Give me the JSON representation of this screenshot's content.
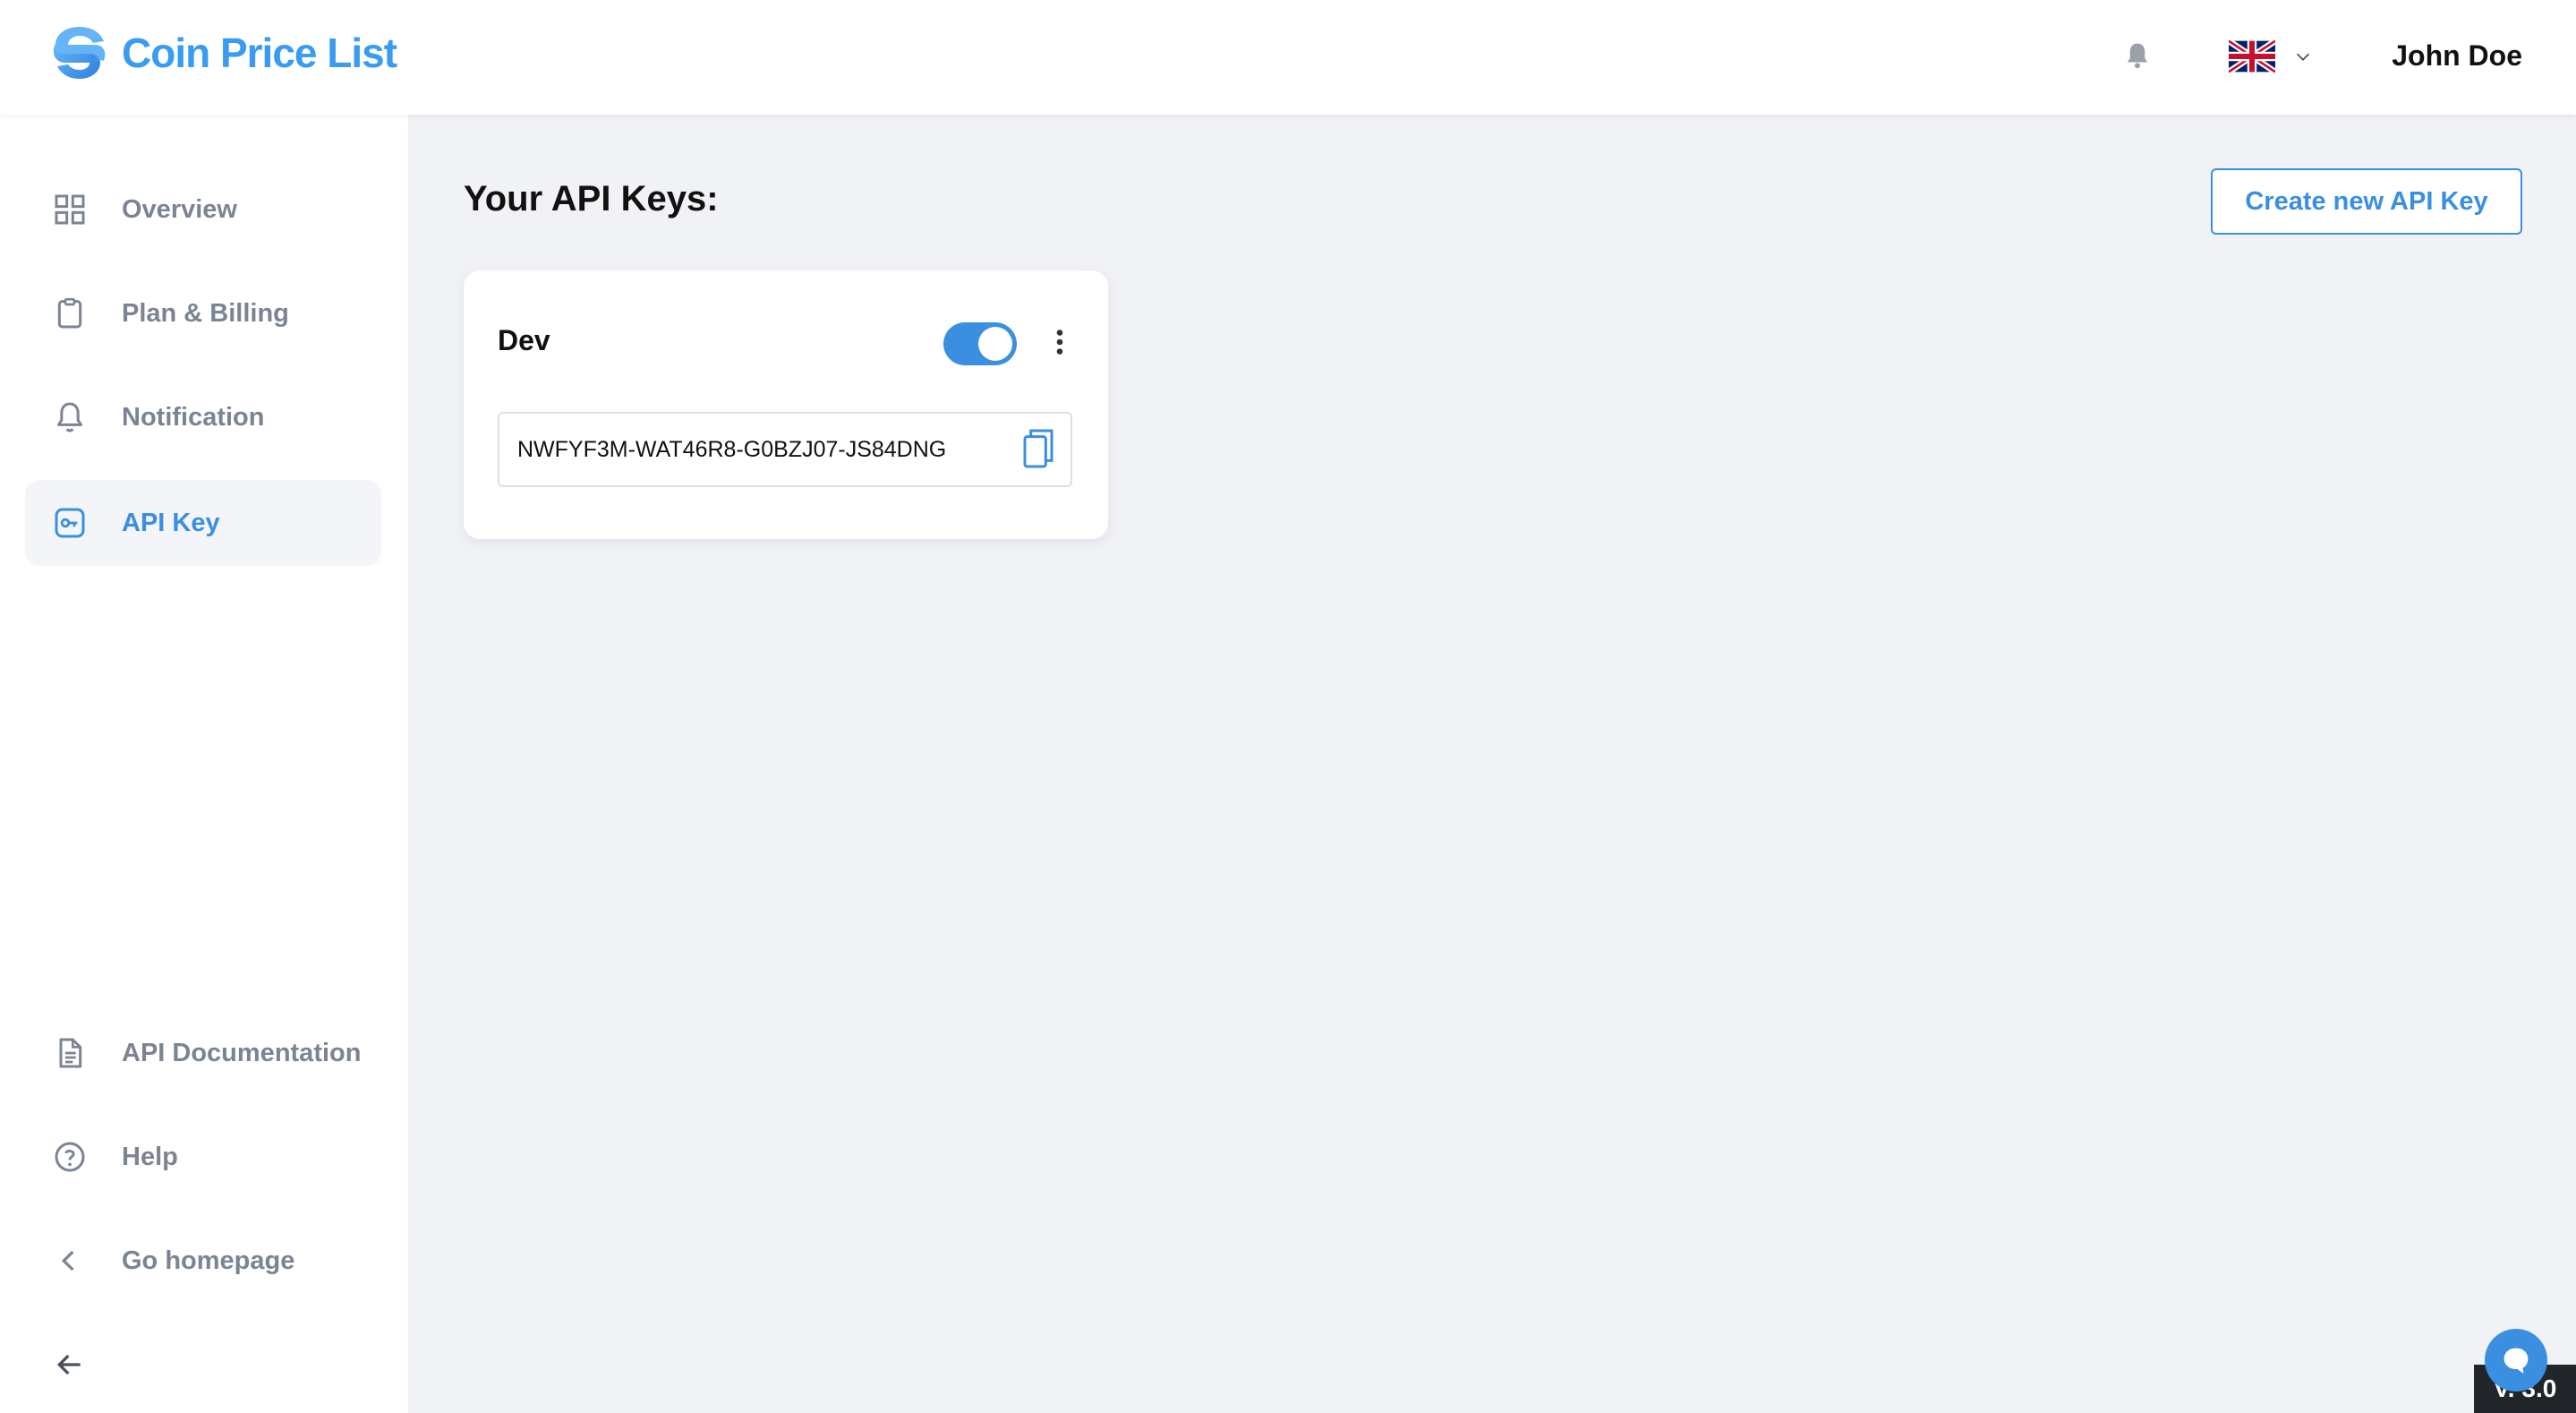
{
  "app": {
    "brand_name": "Coin Price List",
    "accent_color": "#3a8fe0"
  },
  "header": {
    "notification_icon": "bell-icon",
    "language_flag": "uk-flag-icon",
    "user_name": "John Doe"
  },
  "sidebar": {
    "items": [
      {
        "label": "Overview",
        "icon": "grid-icon",
        "active": false
      },
      {
        "label": "Plan & Billing",
        "icon": "clipboard-icon",
        "active": false
      },
      {
        "label": "Notification",
        "icon": "bell-icon",
        "active": false
      },
      {
        "label": "API Key",
        "icon": "key-icon",
        "active": true
      }
    ],
    "bottom_items": [
      {
        "label": "API Documentation",
        "icon": "document-icon"
      },
      {
        "label": "Help",
        "icon": "help-circle-icon"
      },
      {
        "label": "Go homepage",
        "icon": "chevron-left-icon"
      }
    ],
    "collapse_icon": "arrow-left-icon"
  },
  "main": {
    "title": "Your API Keys:",
    "create_button_label": "Create new API Key",
    "api_keys": [
      {
        "name": "Dev",
        "enabled": true,
        "key": "NWFYF3M-WAT46R8-G0BZJ07-JS84DNG"
      }
    ]
  },
  "footer": {
    "version_text": "V. 3.0",
    "chat_icon": "chat-bubble-icon"
  }
}
